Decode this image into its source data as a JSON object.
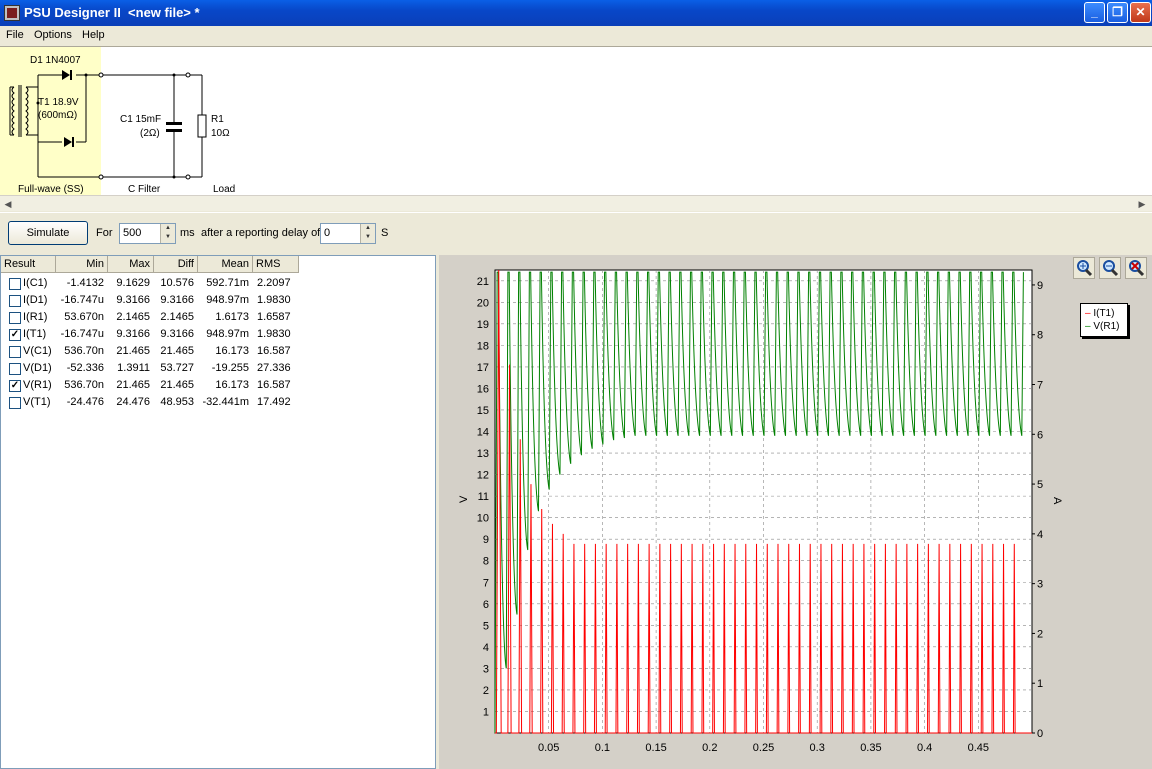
{
  "window": {
    "title": "PSU Designer II  <new file> *"
  },
  "menu": [
    "File",
    "Options",
    "Help"
  ],
  "schematic": {
    "diode": "D1 1N4007",
    "transformer": [
      "T1 18.9V",
      "(600mΩ)"
    ],
    "capacitor": [
      "C1 15mF",
      "(2Ω)"
    ],
    "resistor": [
      "R1",
      "10Ω"
    ],
    "sections": [
      "Full-wave (SS)",
      "C Filter",
      "Load"
    ]
  },
  "toolbar": {
    "simulate": "Simulate",
    "for": "For",
    "duration": "500",
    "duration_unit": "ms",
    "delay_label": "after a reporting delay of",
    "delay": "0",
    "delay_unit": "S"
  },
  "table": {
    "columns": [
      "Result",
      "Min",
      "Max",
      "Diff",
      "Mean",
      "RMS"
    ],
    "rows": [
      {
        "checked": false,
        "name": "I(C1)",
        "min": "-1.4132",
        "max": "9.1629",
        "diff": "10.576",
        "mean": "592.71m",
        "rms": "2.2097"
      },
      {
        "checked": false,
        "name": "I(D1)",
        "min": "-16.747u",
        "max": "9.3166",
        "diff": "9.3166",
        "mean": "948.97m",
        "rms": "1.9830"
      },
      {
        "checked": false,
        "name": "I(R1)",
        "min": "53.670n",
        "max": "2.1465",
        "diff": "2.1465",
        "mean": "1.6173",
        "rms": "1.6587"
      },
      {
        "checked": true,
        "name": "I(T1)",
        "min": "-16.747u",
        "max": "9.3166",
        "diff": "9.3166",
        "mean": "948.97m",
        "rms": "1.9830"
      },
      {
        "checked": false,
        "name": "V(C1)",
        "min": "536.70n",
        "max": "21.465",
        "diff": "21.465",
        "mean": "16.173",
        "rms": "16.587"
      },
      {
        "checked": false,
        "name": "V(D1)",
        "min": "-52.336",
        "max": "1.3911",
        "diff": "53.727",
        "mean": "-19.255",
        "rms": "27.336"
      },
      {
        "checked": true,
        "name": "V(R1)",
        "min": "536.70n",
        "max": "21.465",
        "diff": "21.465",
        "mean": "16.173",
        "rms": "16.587"
      },
      {
        "checked": false,
        "name": "V(T1)",
        "min": "-24.476",
        "max": "24.476",
        "diff": "48.953",
        "mean": "-32.441m",
        "rms": "17.492"
      }
    ]
  },
  "chart_data": {
    "type": "line",
    "xlabel": "",
    "ylabel": "V",
    "y2label": "A",
    "xlim": [
      0,
      0.5
    ],
    "ylim": [
      0,
      21.5
    ],
    "y2lim": [
      0,
      9.3
    ],
    "x_ticks": [
      "0.05",
      "0.1",
      "0.15",
      "0.2",
      "0.25",
      "0.3",
      "0.35",
      "0.4",
      "0.45"
    ],
    "y_ticks": [
      "1",
      "2",
      "3",
      "4",
      "5",
      "6",
      "7",
      "8",
      "9",
      "10",
      "11",
      "12",
      "13",
      "14",
      "15",
      "16",
      "17",
      "18",
      "19",
      "20",
      "21"
    ],
    "y2_ticks": [
      "0",
      "1",
      "2",
      "3",
      "4",
      "5",
      "6",
      "7",
      "8",
      "9"
    ],
    "grid": true,
    "legend": [
      "I(T1)",
      "V(R1)"
    ],
    "series": [
      {
        "name": "I(T1)",
        "axis": "right",
        "color": "#ff0000",
        "period_s": 0.01,
        "steady_peak": 3.8,
        "initial_peaks": [
          9.3,
          7.4,
          5.9,
          5.0,
          4.5,
          4.2,
          4.0
        ]
      },
      {
        "name": "V(R1)",
        "axis": "left",
        "color": "#008000",
        "period_s": 0.01,
        "steady_peak": 21.4,
        "steady_min": 13.8,
        "ripple_mins": [
          3.0,
          5.5,
          8.5,
          10.3,
          11.3,
          12.0,
          12.5,
          12.9,
          13.2,
          13.4,
          13.6,
          13.7
        ]
      }
    ]
  }
}
